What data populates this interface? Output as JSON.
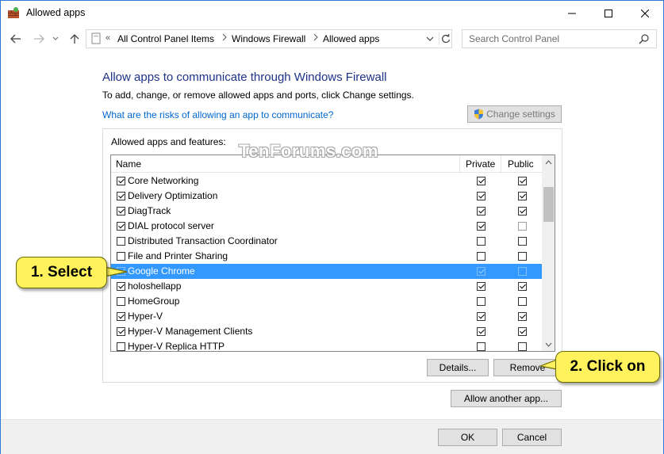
{
  "window": {
    "title": "Allowed apps"
  },
  "address": {
    "recent_chevron": "«",
    "breadcrumbs": [
      "All Control Panel Items",
      "Windows Firewall",
      "Allowed apps"
    ],
    "search_placeholder": "Search Control Panel"
  },
  "main": {
    "title": "Allow apps to communicate through Windows Firewall",
    "instructions": "To add, change, or remove allowed apps and ports, click Change settings.",
    "risk_link": "What are the risks of allowing an app to communicate?",
    "change_settings_label": "Change settings",
    "group_label": "Allowed apps and features:",
    "columns": {
      "name": "Name",
      "private": "Private",
      "public": "Public"
    },
    "apps": [
      {
        "name": "Core Networking",
        "enabled": true,
        "private": true,
        "public": true,
        "selected": false
      },
      {
        "name": "Delivery Optimization",
        "enabled": true,
        "private": true,
        "public": true,
        "selected": false
      },
      {
        "name": "DiagTrack",
        "enabled": true,
        "private": true,
        "public": true,
        "selected": false
      },
      {
        "name": "DIAL protocol server",
        "enabled": true,
        "private": true,
        "public": false,
        "selected": false
      },
      {
        "name": "Distributed Transaction Coordinator",
        "enabled": false,
        "private": false,
        "public": false,
        "selected": false
      },
      {
        "name": "File and Printer Sharing",
        "enabled": false,
        "private": false,
        "public": false,
        "selected": false
      },
      {
        "name": "Google Chrome",
        "enabled": true,
        "private": true,
        "public": false,
        "selected": true
      },
      {
        "name": "holoshellapp",
        "enabled": true,
        "private": true,
        "public": true,
        "selected": false
      },
      {
        "name": "HomeGroup",
        "enabled": false,
        "private": false,
        "public": false,
        "selected": false
      },
      {
        "name": "Hyper-V",
        "enabled": true,
        "private": true,
        "public": true,
        "selected": false
      },
      {
        "name": "Hyper-V Management Clients",
        "enabled": true,
        "private": true,
        "public": true,
        "selected": false
      },
      {
        "name": "Hyper-V Replica HTTP",
        "enabled": false,
        "private": false,
        "public": false,
        "selected": false
      }
    ],
    "details_label": "Details...",
    "remove_label": "Remove",
    "allow_another_label": "Allow another app..."
  },
  "footer": {
    "ok_label": "OK",
    "cancel_label": "Cancel"
  },
  "watermark": "TenForums.com",
  "callouts": {
    "step1": "1. Select",
    "step2": "2. Click on"
  },
  "colors": {
    "title_blue": "#1e3287",
    "link_blue": "#0066cc",
    "selection_blue": "#3399ff",
    "callout_yellow": "#fff25c"
  }
}
